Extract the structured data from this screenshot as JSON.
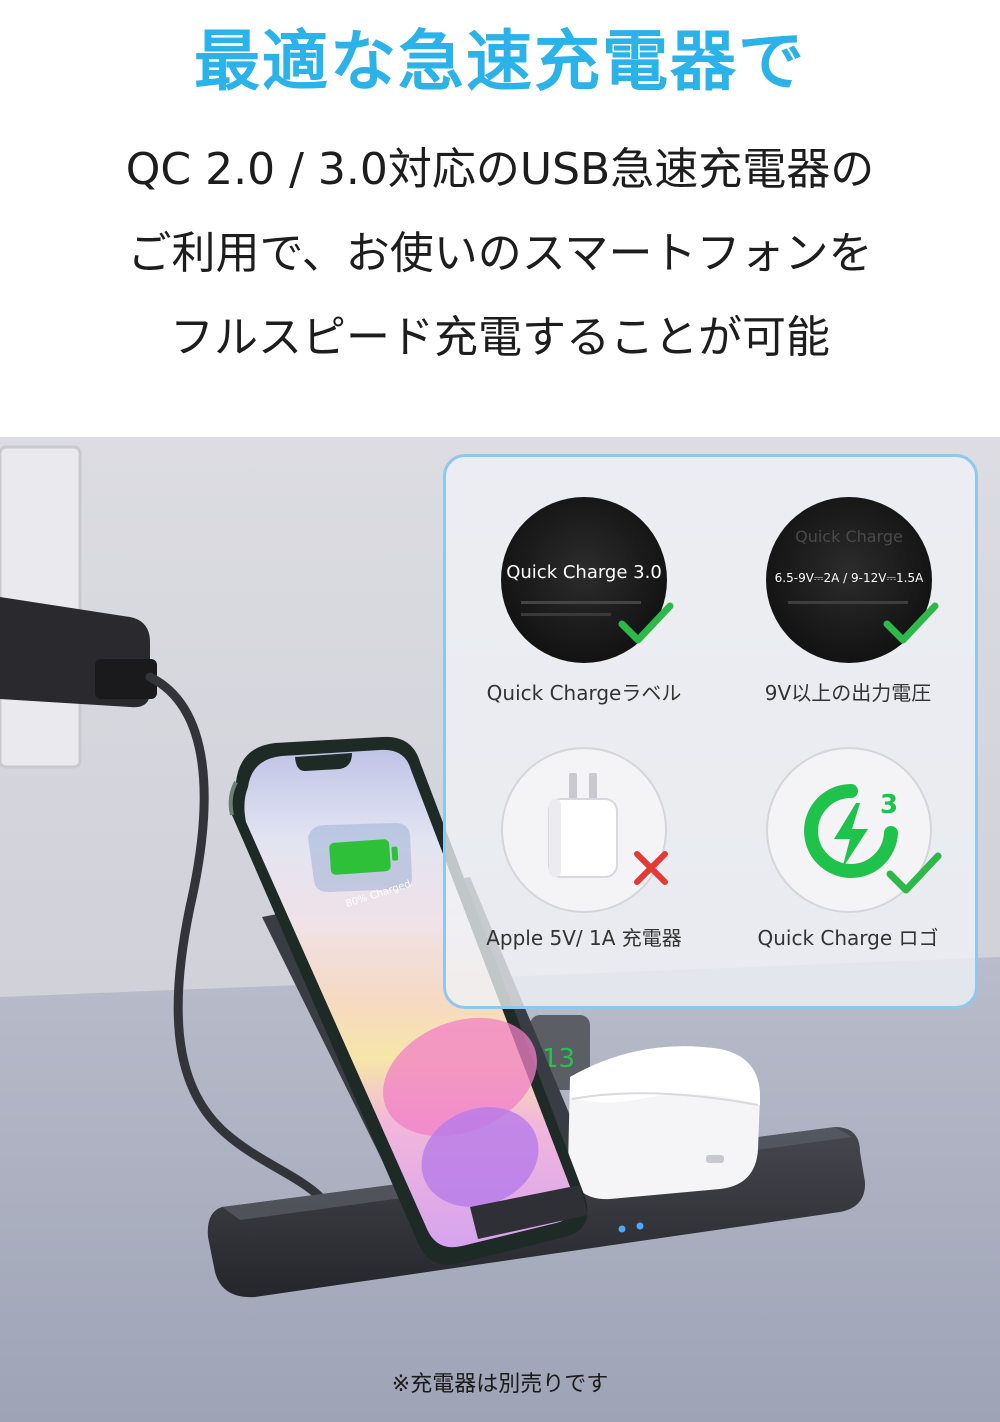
{
  "header": {
    "headline": "最適な急速充電器で",
    "body_lines": [
      "QC 2.0 / 3.0対応のUSB急速充電器の",
      "ご利用で、お使いのスマートフォンを",
      "フルスピード充電することが可能"
    ]
  },
  "phone_screen": {
    "battery_text": "80% Charged"
  },
  "watch_screen": {
    "digits": "13"
  },
  "info_panel": {
    "items": [
      {
        "circle_text": "Quick Charge 3.0",
        "caption": "Quick Chargeラベル",
        "mark": "check-icon",
        "ok": true
      },
      {
        "circle_text": "6.5-9V⎓2A / 9-12V⎓1.5A",
        "circle_text_faint": "Quick Charge",
        "caption": "9V以上の出力電圧",
        "mark": "check-icon",
        "ok": true
      },
      {
        "circle_icon": "power-adapter-icon",
        "caption": "Apple 5V/ 1A 充電器",
        "mark": "cross-icon",
        "ok": false
      },
      {
        "circle_icon": "quick-charge-logo-icon",
        "logo_number": "3",
        "caption": "Quick Charge ロゴ",
        "mark": "check-icon",
        "ok": true
      }
    ]
  },
  "footnote": "※充電器は別売りです",
  "colors": {
    "headline": "#2bb2e8",
    "panel_border": "#8ec8ec",
    "check": "#2fb84a",
    "cross": "#e53935",
    "qc_logo": "#1fc24a"
  }
}
